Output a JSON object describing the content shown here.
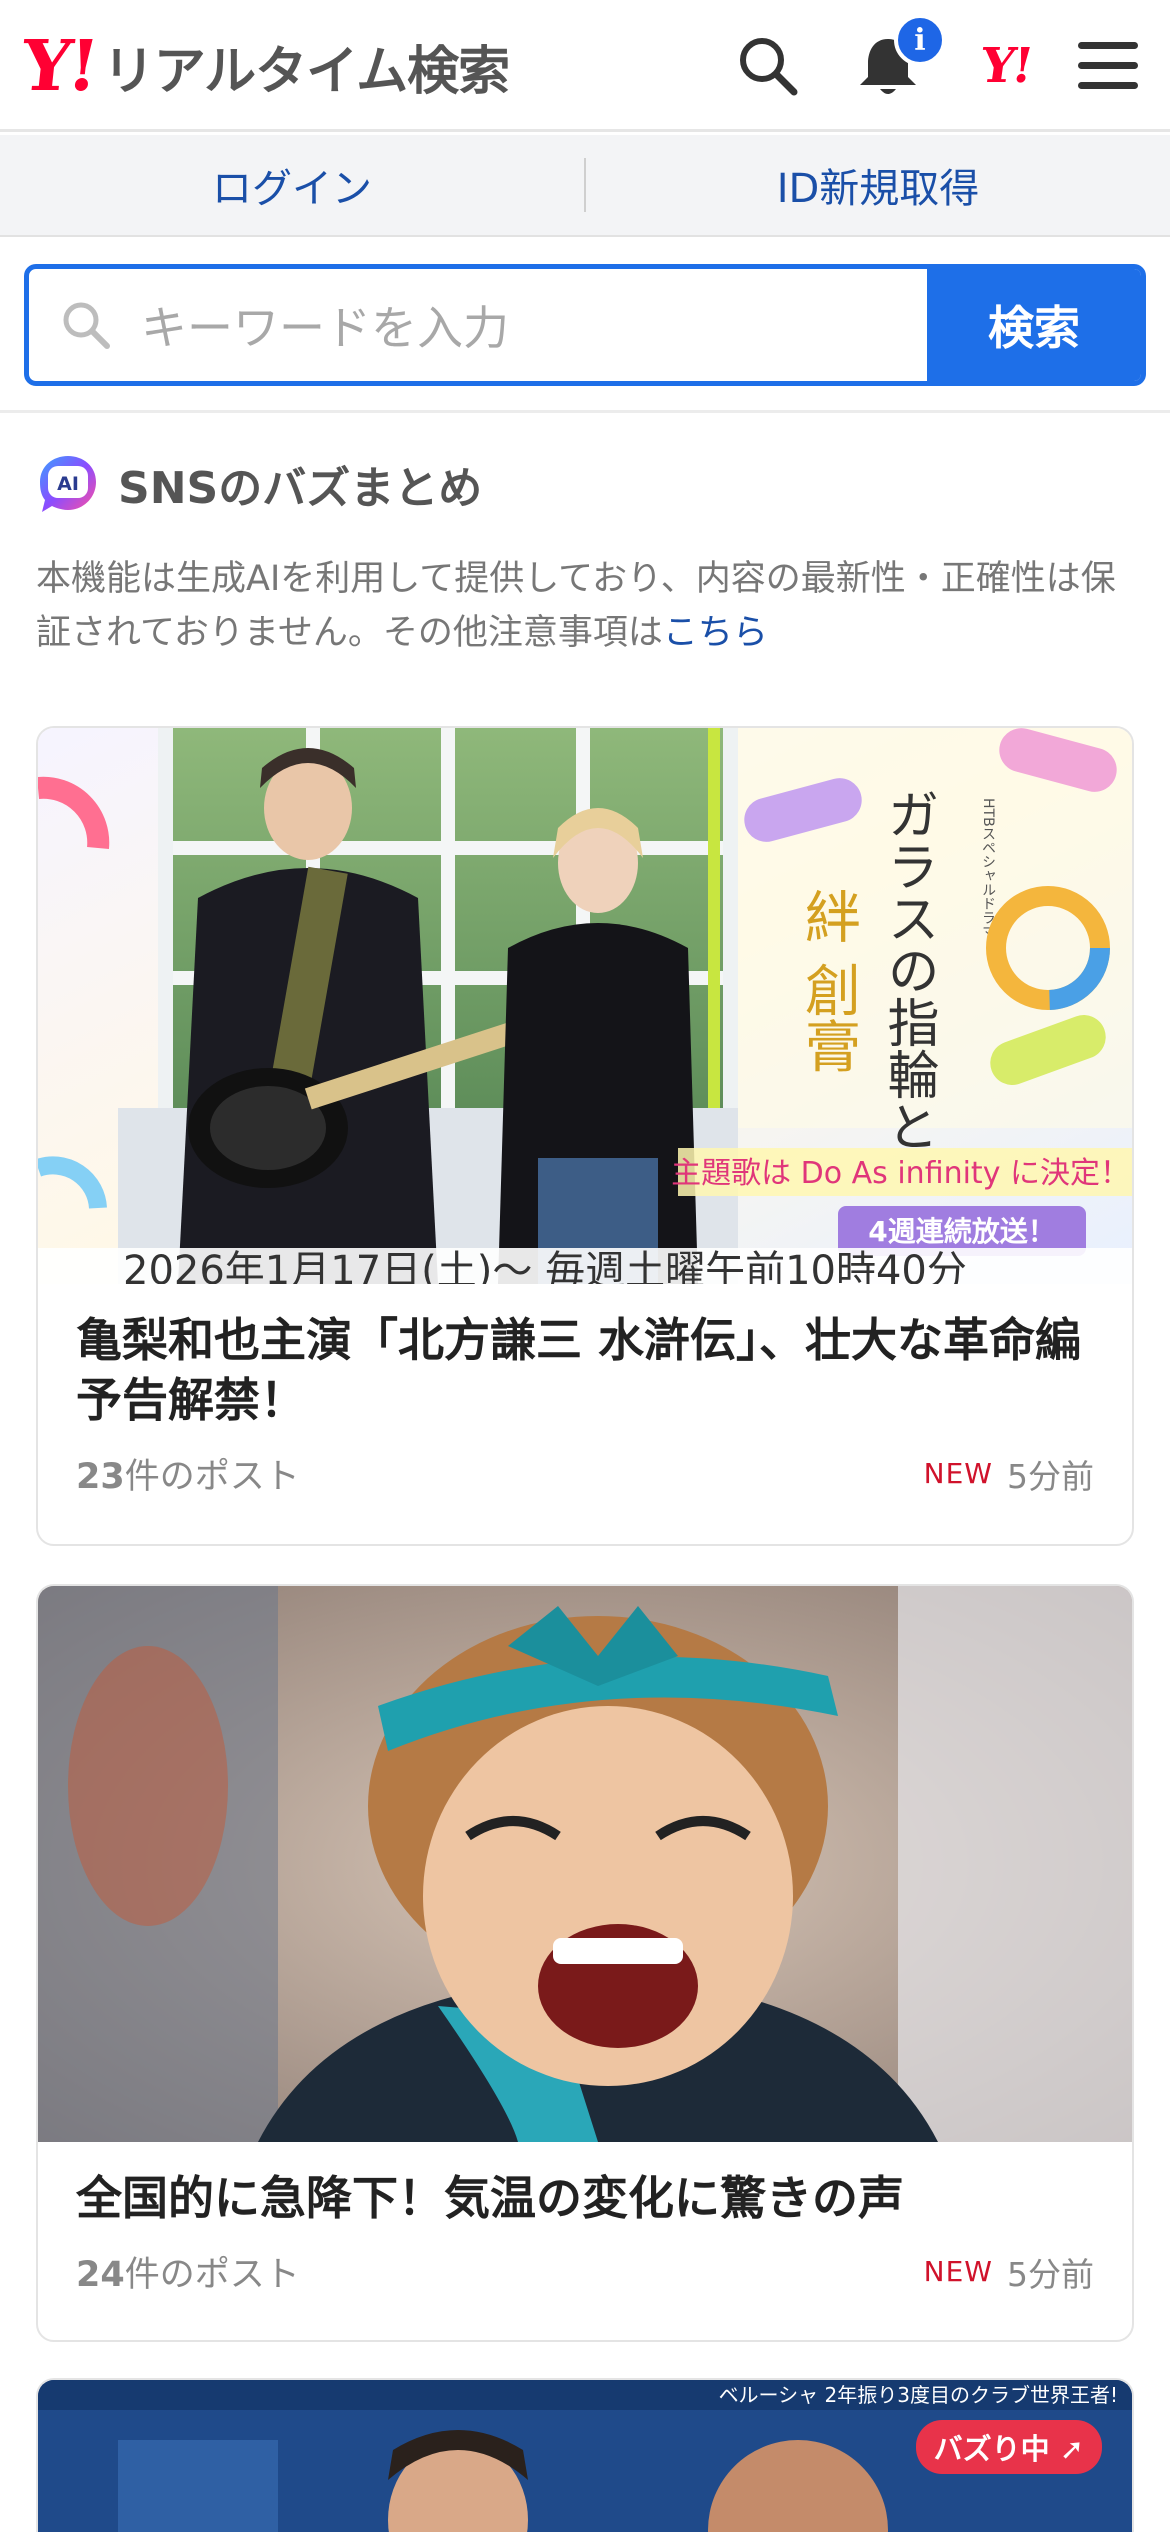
{
  "header": {
    "logo_mark": "Y!",
    "title": "リアルタイム検索",
    "notification_badge": "i",
    "yahoo_mark": "Y!"
  },
  "account": {
    "login_label": "ログイン",
    "register_label": "ID新規取得"
  },
  "search": {
    "placeholder": "キーワードを入力",
    "button_label": "検索"
  },
  "sns_section": {
    "ai_badge": "AI",
    "title": "SNSのバズまとめ",
    "notice_text": "本機能は生成AIを利用して提供しており、内容の最新性・正確性は保証されておりません。その他注意事項は",
    "notice_link": "こちら"
  },
  "cards": [
    {
      "title": "亀梨和也主演「北方謙三 水滸伝」、壮大な革命編予告解禁！",
      "post_count": "23",
      "post_suffix": "件のポスト",
      "new_label": "NEW",
      "time_ago": "5分前",
      "image_text": {
        "drama_label": "HTBスペシャルドラマ",
        "drama_title_1": "ガラスの指輪と",
        "drama_title_2": "絆 創膏",
        "theme_song": "主題歌は Do As infinity に決定！",
        "weeks": "4週連続放送！",
        "date": "2026年1月17日(土)〜 毎週土曜午前10時40分"
      }
    },
    {
      "title": "全国的に急降下！気温の変化に驚きの声",
      "post_count": "24",
      "post_suffix": "件のポスト",
      "new_label": "NEW",
      "time_ago": "5分前"
    },
    {
      "buzz_label": "バズり中",
      "image_caption": "ベルーシャ 2年振り3度目のクラブ世界王者!"
    }
  ]
}
